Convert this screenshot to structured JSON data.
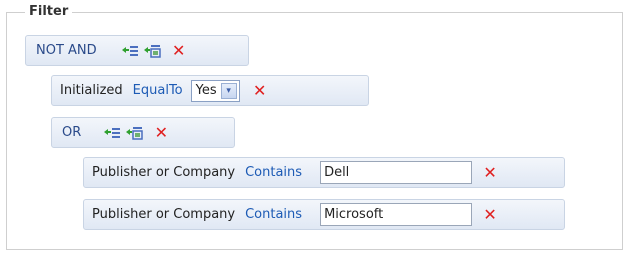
{
  "filter": {
    "legend": "Filter",
    "root": {
      "op": "NOT AND"
    },
    "initialized": {
      "field": "Initialized",
      "condition": "EqualTo",
      "value": "Yes"
    },
    "or": {
      "op": "OR"
    },
    "rows": [
      {
        "field": "Publisher or Company",
        "condition": "Contains",
        "value": "Dell"
      },
      {
        "field": "Publisher or Company",
        "condition": "Contains",
        "value": "Microsoft"
      }
    ]
  },
  "icons": {
    "add_condition": "add-condition-icon",
    "add_group": "add-group-icon",
    "remove": "remove-icon",
    "dropdown": "chevron-down-icon"
  },
  "colors": {
    "operator": "#2a4a8a",
    "condition": "#1d5bb5",
    "remove": "#e02020"
  },
  "symbols": {
    "remove": "✕",
    "chevron": "▾"
  }
}
